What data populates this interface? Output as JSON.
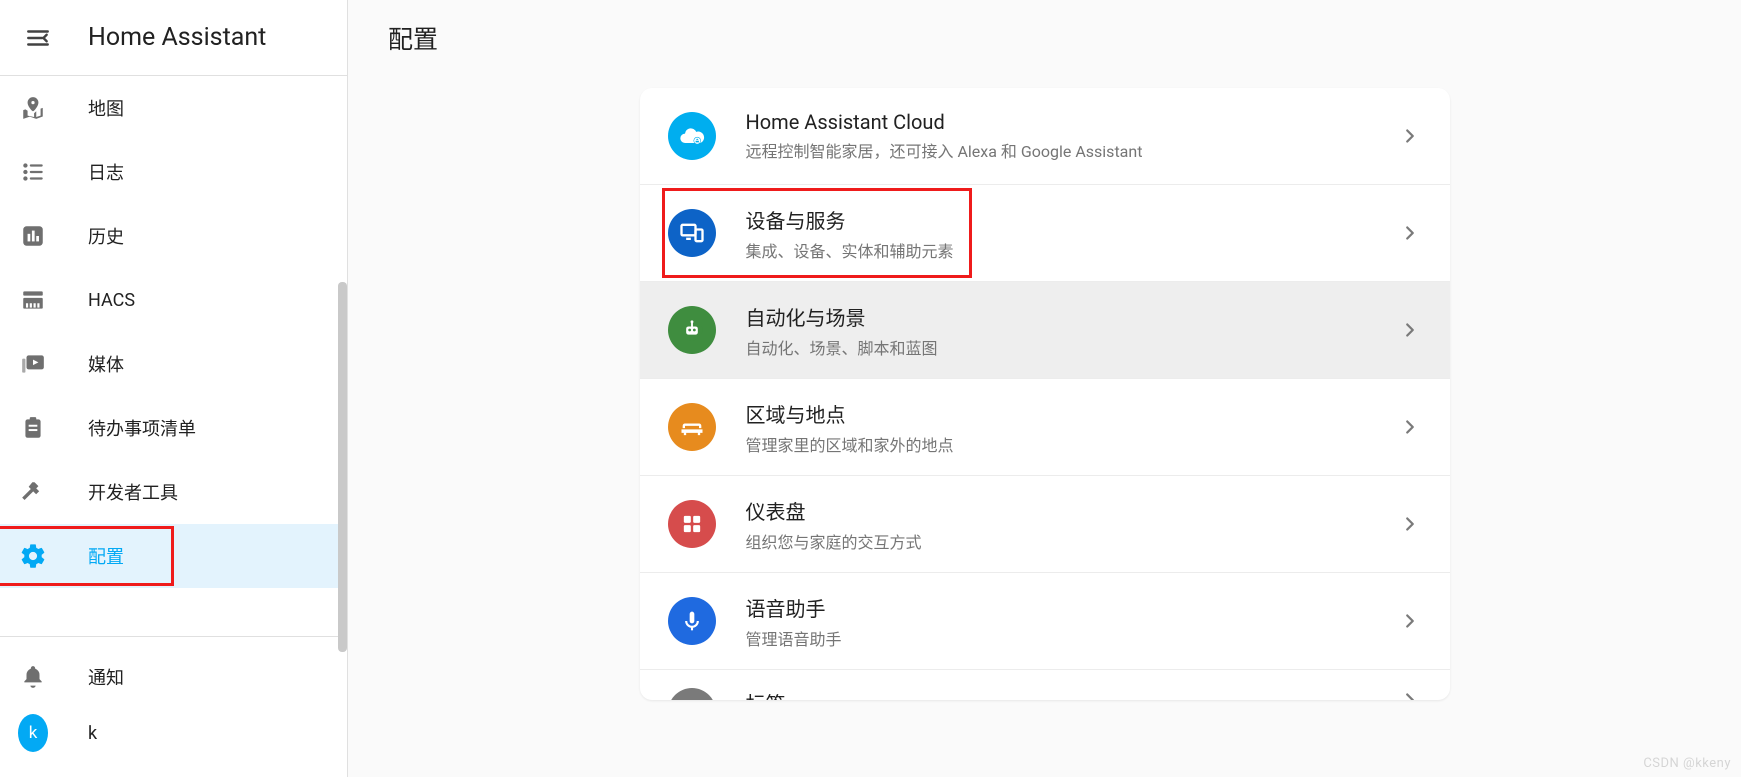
{
  "brand": "Home Assistant",
  "topbar": {
    "title": "配置"
  },
  "sidebar": {
    "items": [
      {
        "key": "map",
        "label": "地图"
      },
      {
        "key": "logbook",
        "label": "日志"
      },
      {
        "key": "history",
        "label": "历史"
      },
      {
        "key": "hacs",
        "label": "HACS"
      },
      {
        "key": "media",
        "label": "媒体"
      },
      {
        "key": "todo",
        "label": "待办事项清单"
      },
      {
        "key": "devtools",
        "label": "开发者工具"
      },
      {
        "key": "config",
        "label": "配置"
      }
    ],
    "notifications_label": "通知"
  },
  "settings": {
    "items": [
      {
        "key": "cloud",
        "title": "Home Assistant Cloud",
        "subtitle": "远程控制智能家居，还可接入 Alexa 和 Google Assistant",
        "color": "#00aeef"
      },
      {
        "key": "devices",
        "title": "设备与服务",
        "subtitle": "集成、设备、实体和辅助元素",
        "color": "#0d63c7"
      },
      {
        "key": "automation",
        "title": "自动化与场景",
        "subtitle": "自动化、场景、脚本和蓝图",
        "color": "#3f8d3f"
      },
      {
        "key": "areas",
        "title": "区域与地点",
        "subtitle": "管理家里的区域和家外的地点",
        "color": "#e78b1e"
      },
      {
        "key": "dashboard",
        "title": "仪表盘",
        "subtitle": "组织您与家庭的交互方式",
        "color": "#d64c4c"
      },
      {
        "key": "voice",
        "title": "语音助手",
        "subtitle": "管理语音助手",
        "color": "#1f6ae0"
      },
      {
        "key": "tags",
        "title": "标签",
        "subtitle": "",
        "color": "#7a7a7a"
      }
    ]
  },
  "watermark": "CSDN @kkeny"
}
